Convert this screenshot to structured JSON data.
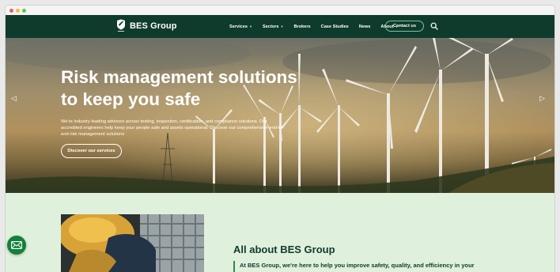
{
  "nav": {
    "brand": "BES Group",
    "items": [
      {
        "label": "Services",
        "dropdown": true
      },
      {
        "label": "Sectors",
        "dropdown": true
      },
      {
        "label": "Brokers",
        "dropdown": false
      },
      {
        "label": "Case Studies",
        "dropdown": false
      },
      {
        "label": "News",
        "dropdown": false
      },
      {
        "label": "About",
        "dropdown": true
      }
    ],
    "contact_label": "Contact us",
    "search_icon": "search-icon"
  },
  "hero": {
    "title": "Risk management solutions to keep you safe",
    "text": "We're industry leading advisors across testing, inspection, certification, and compliance solutions. Our accredited engineers help keep your people safe and assets operational. Discover our comprehensive end-to-end risk management solutions",
    "button": "Discover our services",
    "prev_icon": "chevron-left-icon",
    "next_icon": "chevron-right-icon"
  },
  "about": {
    "title": "All about BES Group",
    "text": "At BES Group, we're here to help you improve safety, quality, and efficiency in your"
  },
  "colors": {
    "nav_bg": "#0f3b2c",
    "section_bg": "#dff0dc",
    "accent": "#14803b"
  },
  "fab": {
    "icon": "mail-icon"
  }
}
